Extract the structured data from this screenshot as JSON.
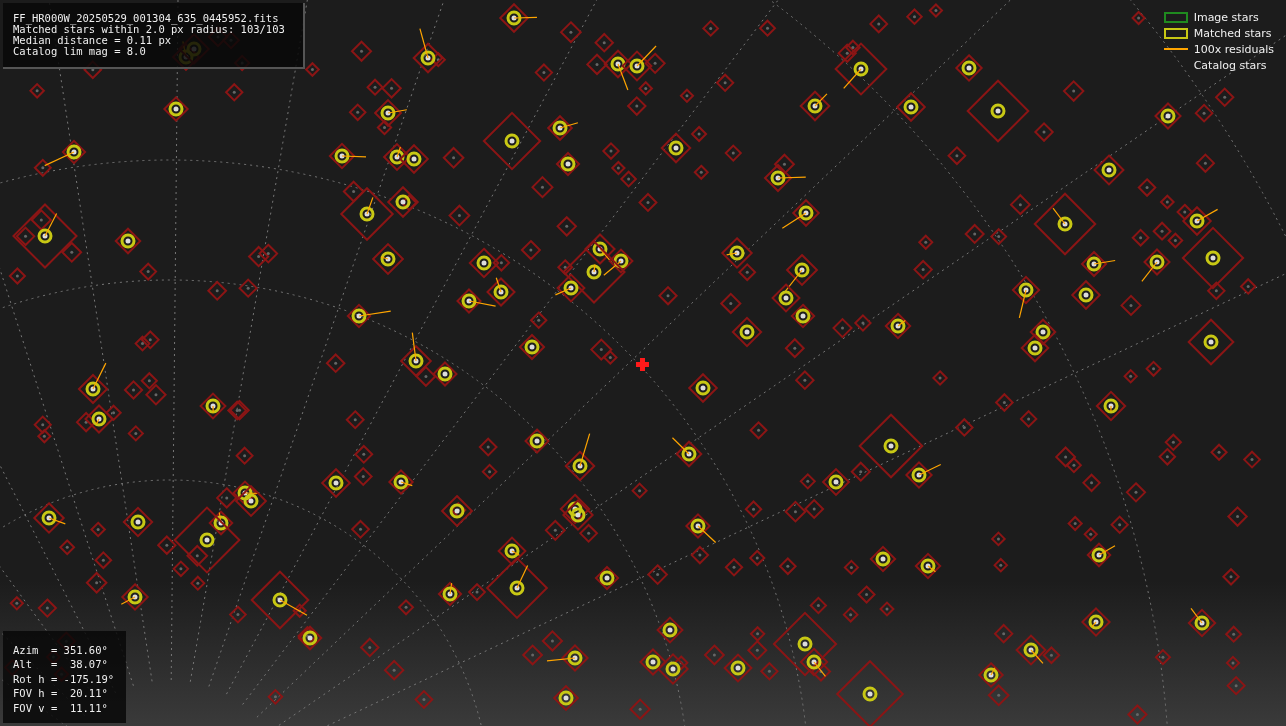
{
  "info_panel": {
    "lines": [
      "FF_HR000W_20250529_001304_635_0445952.fits",
      "Matched stars within 2.0 px radius: 103/103",
      "Median distance = 0.11 px",
      "Catalog lim mag = 8.0"
    ]
  },
  "legend": {
    "items": [
      {
        "label": "Image stars",
        "kind": "box",
        "color": "#1f8a1f"
      },
      {
        "label": "Matched stars",
        "kind": "box",
        "color": "#c8c814"
      },
      {
        "label": "100x residuals",
        "kind": "line",
        "color": "#ffa500"
      },
      {
        "label": "Catalog stars",
        "kind": "blank"
      }
    ]
  },
  "pointing_panel": {
    "lines": [
      "Azim  = 351.60°",
      "Alt   =  38.07°",
      "Rot h = -175.19°",
      "FOV h =  20.11°",
      "FOV v =  11.11°"
    ]
  }
}
